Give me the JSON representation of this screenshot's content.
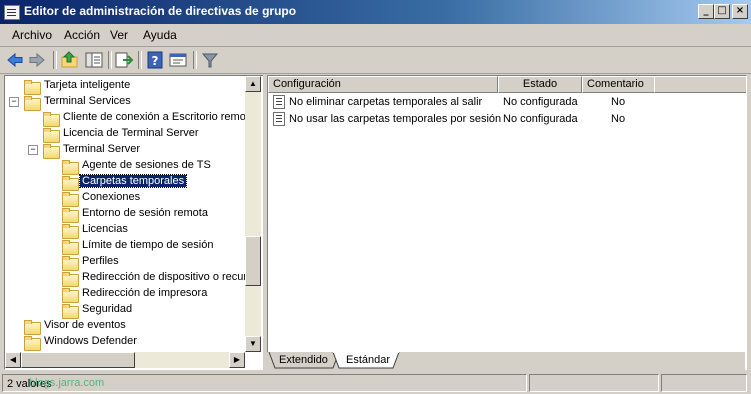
{
  "window": {
    "title": "Editor de administración de directivas de grupo",
    "controls": {
      "minimize": "_",
      "maximize": "□",
      "close": "×"
    }
  },
  "menu": [
    "Archivo",
    "Acción",
    "Ver",
    "Ayuda"
  ],
  "toolbar": {
    "icons": [
      "back-arrow-icon",
      "forward-arrow-icon",
      "up-folder-icon",
      "show-hide-tree-icon",
      "export-list-icon",
      "help-icon",
      "properties-icon",
      "filter-icon"
    ]
  },
  "tree": [
    {
      "label": "Tarjeta inteligente",
      "level": 1,
      "expander": ""
    },
    {
      "label": "Terminal Services",
      "level": 1,
      "expander": "−"
    },
    {
      "label": "Cliente de conexión a Escritorio remoto",
      "level": 2,
      "expander": ""
    },
    {
      "label": "Licencia de Terminal Server",
      "level": 2,
      "expander": ""
    },
    {
      "label": "Terminal Server",
      "level": 2,
      "expander": "−"
    },
    {
      "label": "Agente de sesiones de TS",
      "level": 3,
      "expander": ""
    },
    {
      "label": "Carpetas temporales",
      "level": 3,
      "expander": "",
      "selected": true
    },
    {
      "label": "Conexiones",
      "level": 3,
      "expander": ""
    },
    {
      "label": "Entorno de sesión remota",
      "level": 3,
      "expander": ""
    },
    {
      "label": "Licencias",
      "level": 3,
      "expander": ""
    },
    {
      "label": "Límite de tiempo de sesión",
      "level": 3,
      "expander": ""
    },
    {
      "label": "Perfiles",
      "level": 3,
      "expander": ""
    },
    {
      "label": "Redirección de dispositivo o recursos",
      "level": 3,
      "expander": ""
    },
    {
      "label": "Redirección de impresora",
      "level": 3,
      "expander": ""
    },
    {
      "label": "Seguridad",
      "level": 3,
      "expander": ""
    },
    {
      "label": "Visor de eventos",
      "level": 1,
      "expander": ""
    },
    {
      "label": "Windows Defender",
      "level": 1,
      "expander": ""
    }
  ],
  "list": {
    "columns": [
      "Configuración",
      "Estado",
      "Comentario"
    ],
    "rows": [
      {
        "setting": "No eliminar carpetas temporales al salir",
        "state": "No configurada",
        "comment": "No"
      },
      {
        "setting": "No usar las carpetas temporales por sesión",
        "state": "No configurada",
        "comment": "No"
      }
    ]
  },
  "tabs": [
    "Extendido",
    "Estándar"
  ],
  "active_tab": "Estándar",
  "status": {
    "text": "2 valores",
    "watermark": "blogs.jarra.com"
  },
  "scroll": {
    "vertical_position": 0.62
  },
  "colors": {
    "selection": "#0a246a",
    "title_start": "#0a246a",
    "title_end": "#a6caf0"
  }
}
